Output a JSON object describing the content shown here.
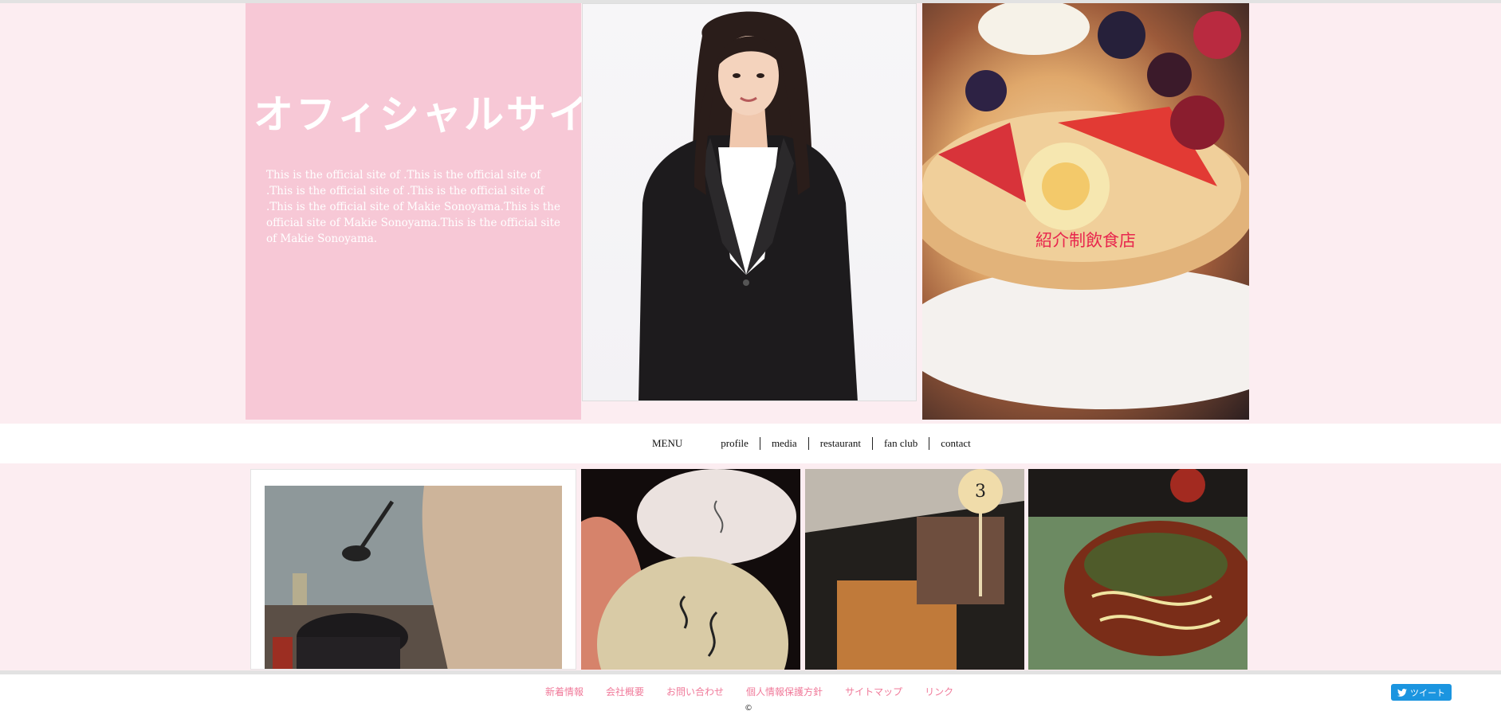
{
  "hero": {
    "title": "オフィシャルサイト",
    "intro": "This is the official site of .This is the official site of .This is the official site of .This is the official site of .This is the official site of Makie Sonoyama.This is the official site of Makie Sonoyama.This is the official site of Makie Sonoyama.",
    "food_label": "紹介制飲食店"
  },
  "nav": {
    "menu_label": "MENU",
    "items": [
      "profile",
      "media",
      "restaurant",
      "fan club",
      "contact"
    ]
  },
  "footer": {
    "links": [
      "新着情報",
      "会社概要",
      "お問い合わせ",
      "個人情報保護方針",
      "サイトマップ",
      "リンク"
    ],
    "copyright": "©",
    "tweet_label": "ツイート"
  },
  "colors": {
    "page_bg": "#fcedf1",
    "hero_pink": "#f7c8d6",
    "food_label": "#e8264e",
    "footer_link": "#f07a9a",
    "tweet_blue": "#1b95e0"
  }
}
